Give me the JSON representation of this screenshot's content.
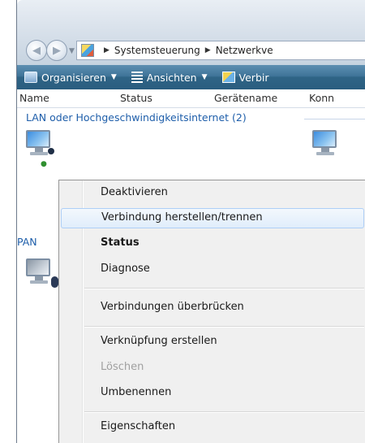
{
  "address": {
    "crumbs": [
      "Systemsteuerung",
      "Netzwerkve"
    ]
  },
  "toolbar": {
    "organize_label": "Organisieren",
    "views_label": "Ansichten",
    "connect_label": "Verbir"
  },
  "columns": {
    "name": "Name",
    "status": "Status",
    "device": "Gerätename",
    "connectivity": "Konn"
  },
  "groups": {
    "lan_header": "LAN oder Hochgeschwindigkeitsinternet (2)",
    "pan_header": "PAN"
  },
  "context_menu": {
    "items": [
      {
        "label": "Deaktivieren"
      },
      {
        "label": "Verbindung herstellen/trennen"
      },
      {
        "label": "Status"
      },
      {
        "label": "Diagnose"
      },
      {
        "label": "Verbindungen überbrücken"
      },
      {
        "label": "Verknüpfung erstellen"
      },
      {
        "label": "Löschen"
      },
      {
        "label": "Umbenennen"
      },
      {
        "label": "Eigenschaften"
      }
    ]
  },
  "icons": {
    "back": "back-arrow-icon",
    "forward": "forward-arrow-icon",
    "control_panel": "control-panel-icon",
    "organize": "organize-icon",
    "views": "views-icon",
    "connect": "connect-icon",
    "network_adapter": "network-adapter-icon"
  },
  "colors": {
    "toolbar": "#3f7499",
    "group_header": "#1e5eaa",
    "menu_highlight_border": "#aecff7",
    "menu_background": "#f0f0f0"
  }
}
